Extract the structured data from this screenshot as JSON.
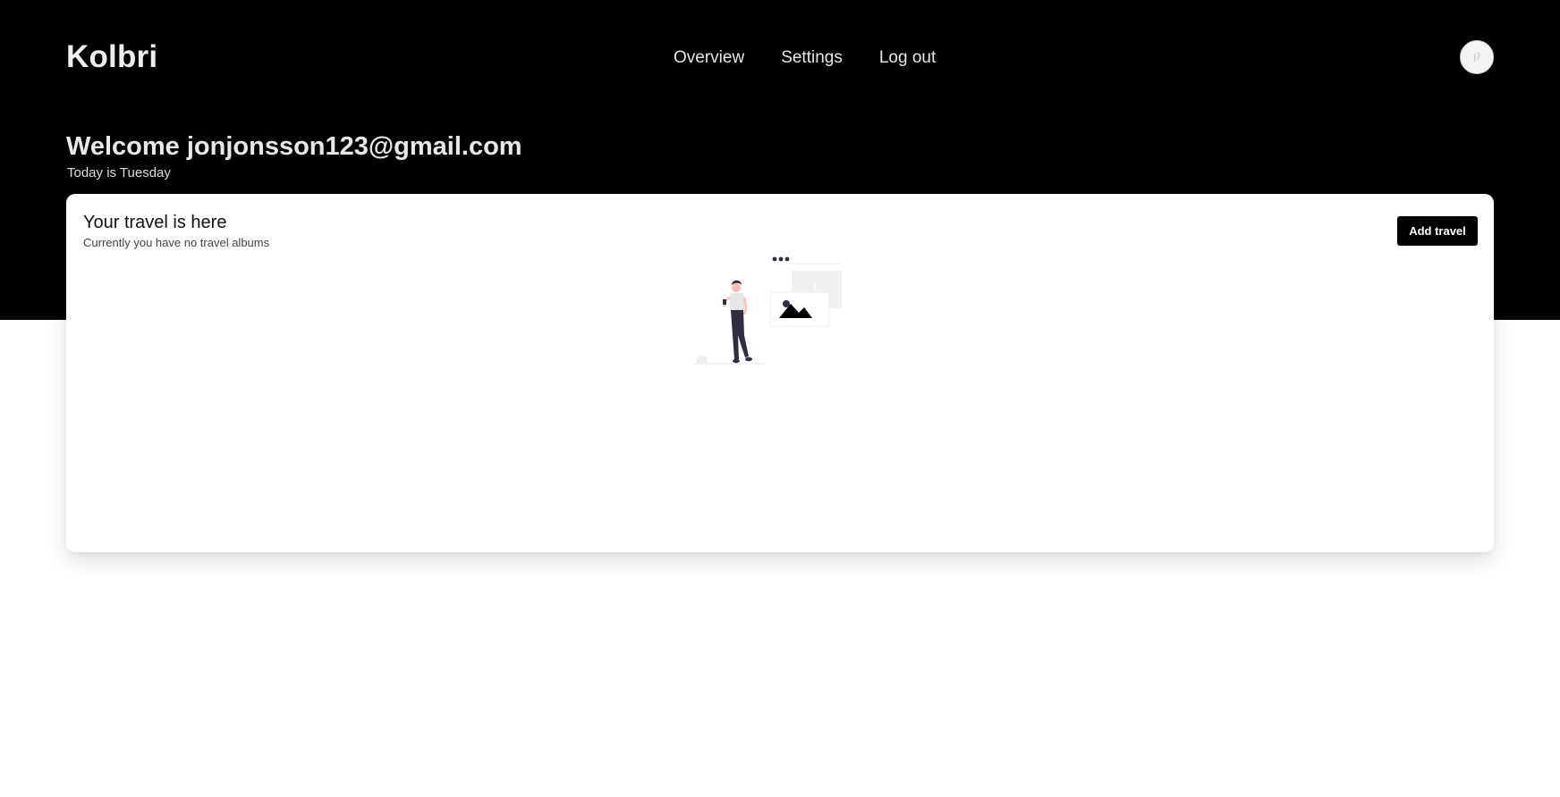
{
  "nav": {
    "brand": "Kolbri",
    "links": [
      "Overview",
      "Settings",
      "Log out"
    ]
  },
  "header": {
    "welcome": "Welcome jonjonsson123@gmail.com",
    "today": "Today is Tuesday"
  },
  "card": {
    "title": "Your travel is here",
    "subtitle": "Currently you have no travel albums",
    "add_label": "Add travel"
  },
  "icons": {
    "avatar": "user-avatar-icon",
    "empty_state": "empty-album-illustration"
  },
  "colors": {
    "hero_background": "#000000",
    "page_background": "#ffffff",
    "button_background": "#000000",
    "button_text": "#ffffff"
  }
}
